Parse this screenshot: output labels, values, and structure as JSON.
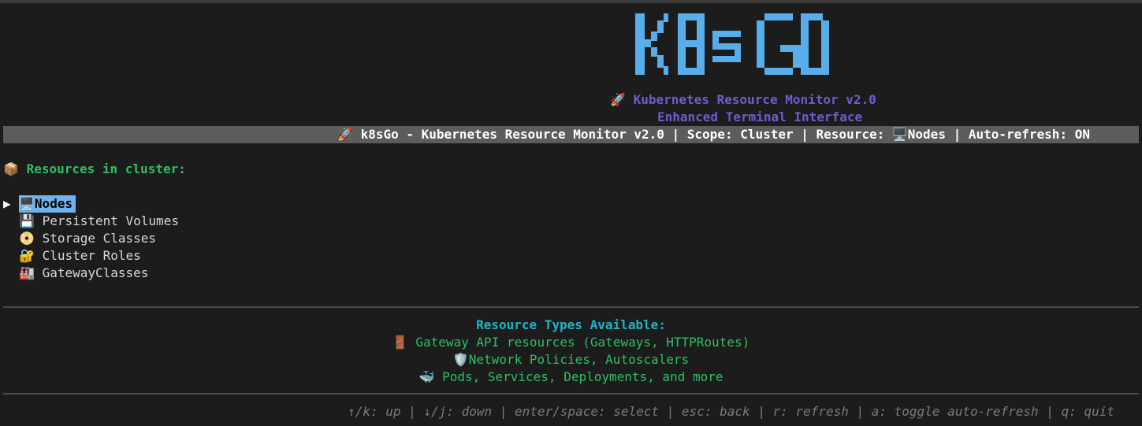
{
  "logo": {
    "text": "K8SGO",
    "color": "#58aeea"
  },
  "title": {
    "line1_icon": "rocket-icon",
    "line1_glyph": "🚀",
    "line1_text": "Kubernetes Resource Monitor v2.0",
    "line2_text": "Enhanced Terminal Interface"
  },
  "status_bar": {
    "icon_glyph": "🚀",
    "text": "k8sGo - Kubernetes Resource Monitor v2.0 | Scope: Cluster | Resource: 🖥️Nodes | Auto-refresh: ON"
  },
  "resources": {
    "heading_icon": "package-icon",
    "heading_glyph": "📦",
    "heading": "Resources in cluster:",
    "pointer": "▶",
    "items": [
      {
        "glyph": "🖥️",
        "icon": "desktop-icon",
        "label": "Nodes",
        "selected": true
      },
      {
        "glyph": "💾",
        "icon": "floppy-disk-icon",
        "label": "Persistent Volumes",
        "selected": false
      },
      {
        "glyph": "📀",
        "icon": "dvd-icon",
        "label": "Storage Classes",
        "selected": false
      },
      {
        "glyph": "🔐",
        "icon": "lock-with-key-icon",
        "label": "Cluster Roles",
        "selected": false
      },
      {
        "glyph": "🏭",
        "icon": "factory-icon",
        "label": "GatewayClasses",
        "selected": false
      }
    ]
  },
  "resource_types": {
    "heading": "Resource Types Available:",
    "lines": [
      {
        "glyph": "🚪",
        "icon": "door-icon",
        "text": "Gateway API resources (Gateways, HTTPRoutes)"
      },
      {
        "glyph": "🛡️",
        "icon": "shield-icon",
        "text": "Network Policies, Autoscalers"
      },
      {
        "glyph": "🐳",
        "icon": "whale-icon",
        "text": "Pods, Services, Deployments, and more"
      }
    ]
  },
  "help": {
    "text": "↑/k: up | ↓/j: down | enter/space: select | esc: back | r: refresh | a: toggle auto-refresh | q: quit"
  },
  "colors": {
    "background": "#1c1c1c",
    "accent_purple": "#6a5fd0",
    "accent_green": "#2fbf68",
    "accent_cyan": "#1fb5c4",
    "selection": "#6fb3ec",
    "status_bar": "#5c5c5c"
  }
}
